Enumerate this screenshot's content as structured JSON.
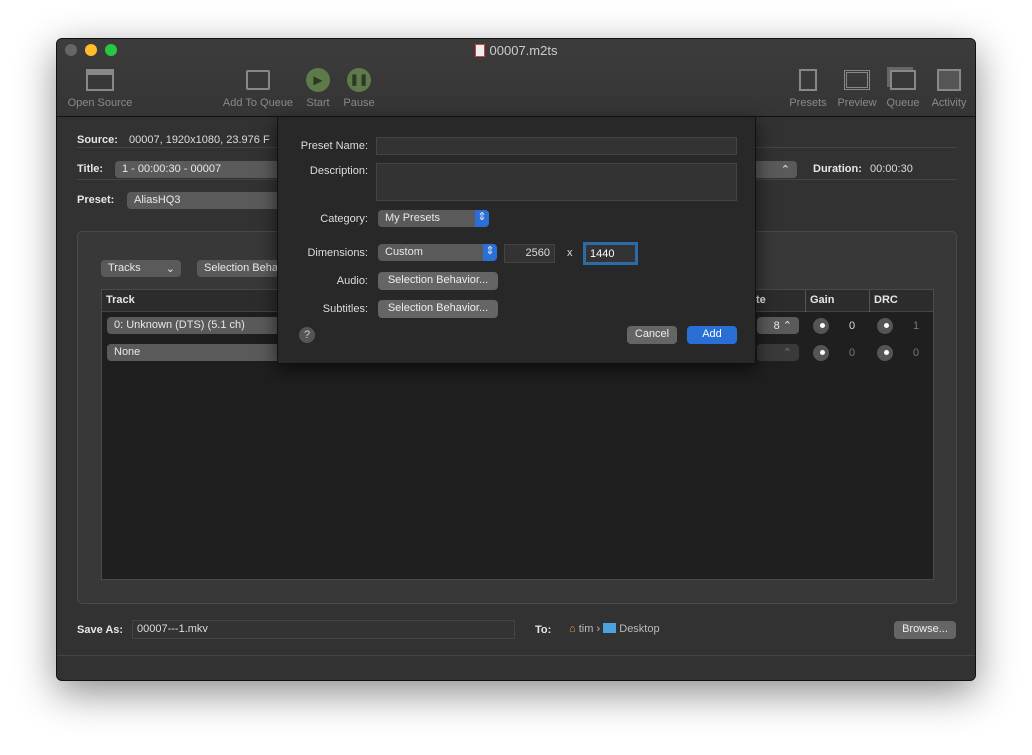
{
  "window": {
    "title": "00007.m2ts",
    "file_icon": "document-icon"
  },
  "toolbar": {
    "open_source": "Open Source",
    "add_to_queue": "Add To Queue",
    "start": "Start",
    "pause": "Pause",
    "presets": "Presets",
    "preview": "Preview",
    "queue": "Queue",
    "activity": "Activity"
  },
  "main": {
    "source_label": "Source:",
    "source_value": "00007, 1920x1080, 23.976 F",
    "title_label": "Title:",
    "title_value": "1 - 00:00:30 - 00007",
    "preset_label": "Preset:",
    "preset_value": "AliasHQ3",
    "duration_label": "Duration:",
    "duration_value": "00:00:30"
  },
  "audio": {
    "tracks_popup": "Tracks",
    "selection_button": "Selection Beha",
    "columns": {
      "track": "Track",
      "rate": "te",
      "gain": "Gain",
      "drc": "DRC"
    },
    "rows": [
      {
        "track": "0: Unknown (DTS) (5.1 ch)",
        "rate": "8",
        "gain": "0",
        "drc": "1"
      },
      {
        "track": "None",
        "rate": "",
        "gain": "0",
        "drc": "0"
      }
    ]
  },
  "save": {
    "label": "Save As:",
    "value": "00007---1.mkv",
    "to_label": "To:",
    "path_home": "tim",
    "path_sep": "›",
    "path_folder": "Desktop",
    "browse": "Browse..."
  },
  "sheet": {
    "preset_name_label": "Preset Name:",
    "preset_name_value": "",
    "description_label": "Description:",
    "description_value": "",
    "category_label": "Category:",
    "category_value": "My Presets",
    "dimensions_label": "Dimensions:",
    "dimensions_value": "Custom",
    "width": "2560",
    "x": "x",
    "height": "1440",
    "audio_label": "Audio:",
    "audio_button": "Selection Behavior...",
    "subtitles_label": "Subtitles:",
    "subtitles_button": "Selection Behavior...",
    "help": "?",
    "cancel": "Cancel",
    "add": "Add",
    "accent": "#2a6fd6"
  }
}
